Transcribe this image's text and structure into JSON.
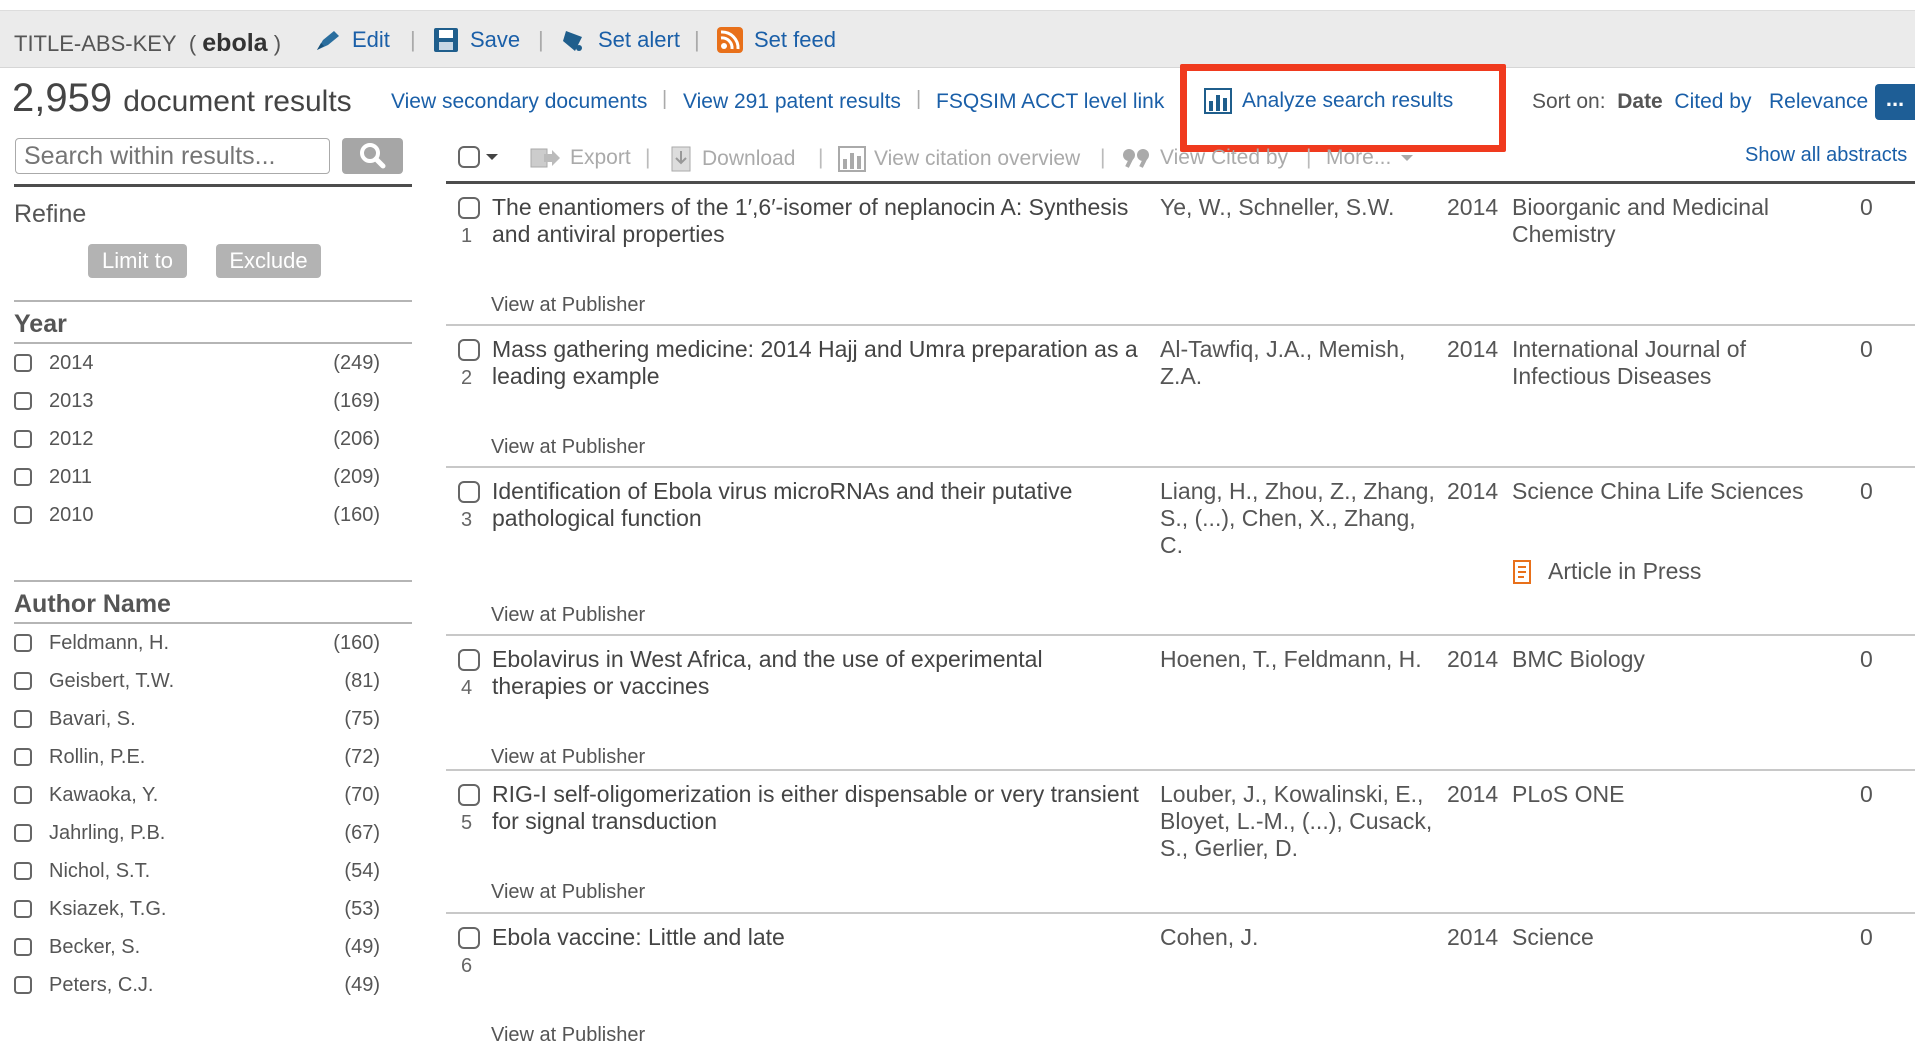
{
  "query": {
    "field": "TITLE-ABS-KEY",
    "open_paren": "(",
    "term": "ebola",
    "close_paren": ")",
    "edit": "Edit",
    "save": "Save",
    "set_alert": "Set alert",
    "set_feed": "Set feed"
  },
  "header": {
    "count": "2,959",
    "count_label": "document results",
    "secondary": "View secondary documents",
    "patents": "View 291 patent results",
    "fsqsim": "FSQSIM ACCT level link",
    "analyze": "Analyze search results",
    "sort_label": "Sort on:",
    "sort_date": "Date",
    "sort_cited": "Cited by",
    "sort_relevance": "Relevance",
    "more": "..."
  },
  "search": {
    "placeholder": "Search within results..."
  },
  "refine": {
    "title": "Refine",
    "limit": "Limit to",
    "exclude": "Exclude"
  },
  "year_facet": {
    "title": "Year",
    "items": [
      {
        "label": "2014",
        "count": "(249)"
      },
      {
        "label": "2013",
        "count": "(169)"
      },
      {
        "label": "2012",
        "count": "(206)"
      },
      {
        "label": "2011",
        "count": "(209)"
      },
      {
        "label": "2010",
        "count": "(160)"
      }
    ]
  },
  "author_facet": {
    "title": "Author Name",
    "items": [
      {
        "label": "Feldmann, H.",
        "count": "(160)"
      },
      {
        "label": "Geisbert, T.W.",
        "count": "(81)"
      },
      {
        "label": "Bavari, S.",
        "count": "(75)"
      },
      {
        "label": "Rollin, P.E.",
        "count": "(72)"
      },
      {
        "label": "Kawaoka, Y.",
        "count": "(70)"
      },
      {
        "label": "Jahrling, P.B.",
        "count": "(67)"
      },
      {
        "label": "Nichol, S.T.",
        "count": "(54)"
      },
      {
        "label": "Ksiazek, T.G.",
        "count": "(53)"
      },
      {
        "label": "Becker, S.",
        "count": "(49)"
      },
      {
        "label": "Peters, C.J.",
        "count": "(49)"
      }
    ]
  },
  "toolbar": {
    "export": "Export",
    "download": "Download",
    "citation": "View citation overview",
    "cited_by": "View Cited by",
    "more": "More...",
    "show_abstracts": "Show all abstracts"
  },
  "results": [
    {
      "num": "1",
      "title": "The enantiomers of the 1′,6′-isomer of neplanocin A: Synthesis and antiviral properties",
      "authors": "Ye, W., Schneller, S.W.",
      "year": "2014",
      "source": "Bioorganic and Medicinal Chemistry",
      "cited": "0",
      "publisher": "View at Publisher",
      "badge": ""
    },
    {
      "num": "2",
      "title": "Mass gathering medicine: 2014 Hajj and Umra preparation as a leading example",
      "authors": "Al-Tawfiq, J.A., Memish, Z.A.",
      "year": "2014",
      "source": "International Journal of Infectious Diseases",
      "cited": "0",
      "publisher": "View at Publisher",
      "badge": ""
    },
    {
      "num": "3",
      "title": "Identification of Ebola virus microRNAs and their putative pathological function",
      "authors": "Liang, H., Zhou, Z., Zhang, S., (...), Chen, X., Zhang, C.",
      "year": "2014",
      "source": "Science China Life Sciences",
      "cited": "0",
      "publisher": "View at Publisher",
      "badge": "Article in Press"
    },
    {
      "num": "4",
      "title": "Ebolavirus in West Africa, and the use of experimental therapies or vaccines",
      "authors": "Hoenen, T., Feldmann, H.",
      "year": "2014",
      "source": "BMC Biology",
      "cited": "0",
      "publisher": "View at Publisher",
      "badge": ""
    },
    {
      "num": "5",
      "title": "RIG-I self-oligomerization is either dispensable or very transient for signal transduction",
      "authors": "Louber, J., Kowalinski, E., Bloyet, L.-M., (...), Cusack, S., Gerlier, D.",
      "year": "2014",
      "source": "PLoS ONE",
      "cited": "0",
      "publisher": "View at Publisher",
      "badge": ""
    },
    {
      "num": "6",
      "title": "Ebola vaccine: Little and late",
      "authors": "Cohen, J.",
      "year": "2014",
      "source": "Science",
      "cited": "0",
      "publisher": "View at Publisher",
      "badge": ""
    }
  ],
  "colors": {
    "link": "#1a5fa8",
    "highlight": "#f03a1e",
    "sort_button": "#1e5e96"
  }
}
